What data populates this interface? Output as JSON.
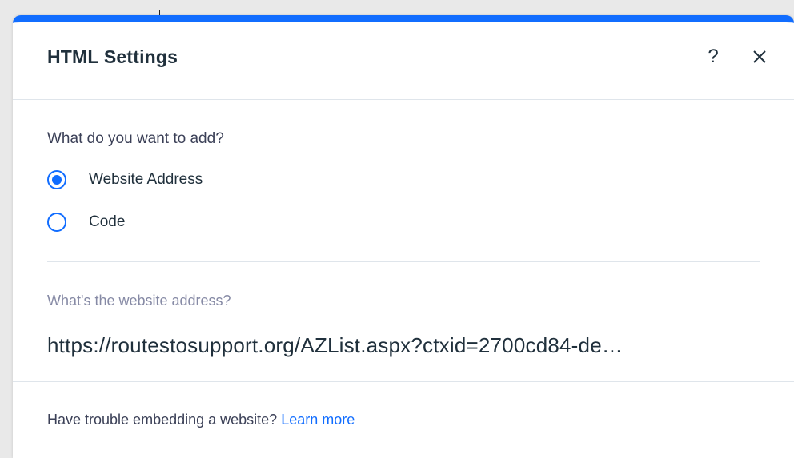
{
  "dialog": {
    "title": "HTML Settings",
    "help_icon": "question-mark-icon",
    "close_icon": "close-x-icon",
    "accent_color": "#116dff"
  },
  "content": {
    "question": "What do you want to add?",
    "options": [
      {
        "label": "Website Address",
        "selected": true
      },
      {
        "label": "Code",
        "selected": false
      }
    ],
    "address_label": "What's the website address?",
    "address_value": "https://routestosupport.org/AZList.aspx?ctxid=2700cd84-de…"
  },
  "footer": {
    "text": "Have trouble embedding a website?",
    "link": "Learn more"
  }
}
